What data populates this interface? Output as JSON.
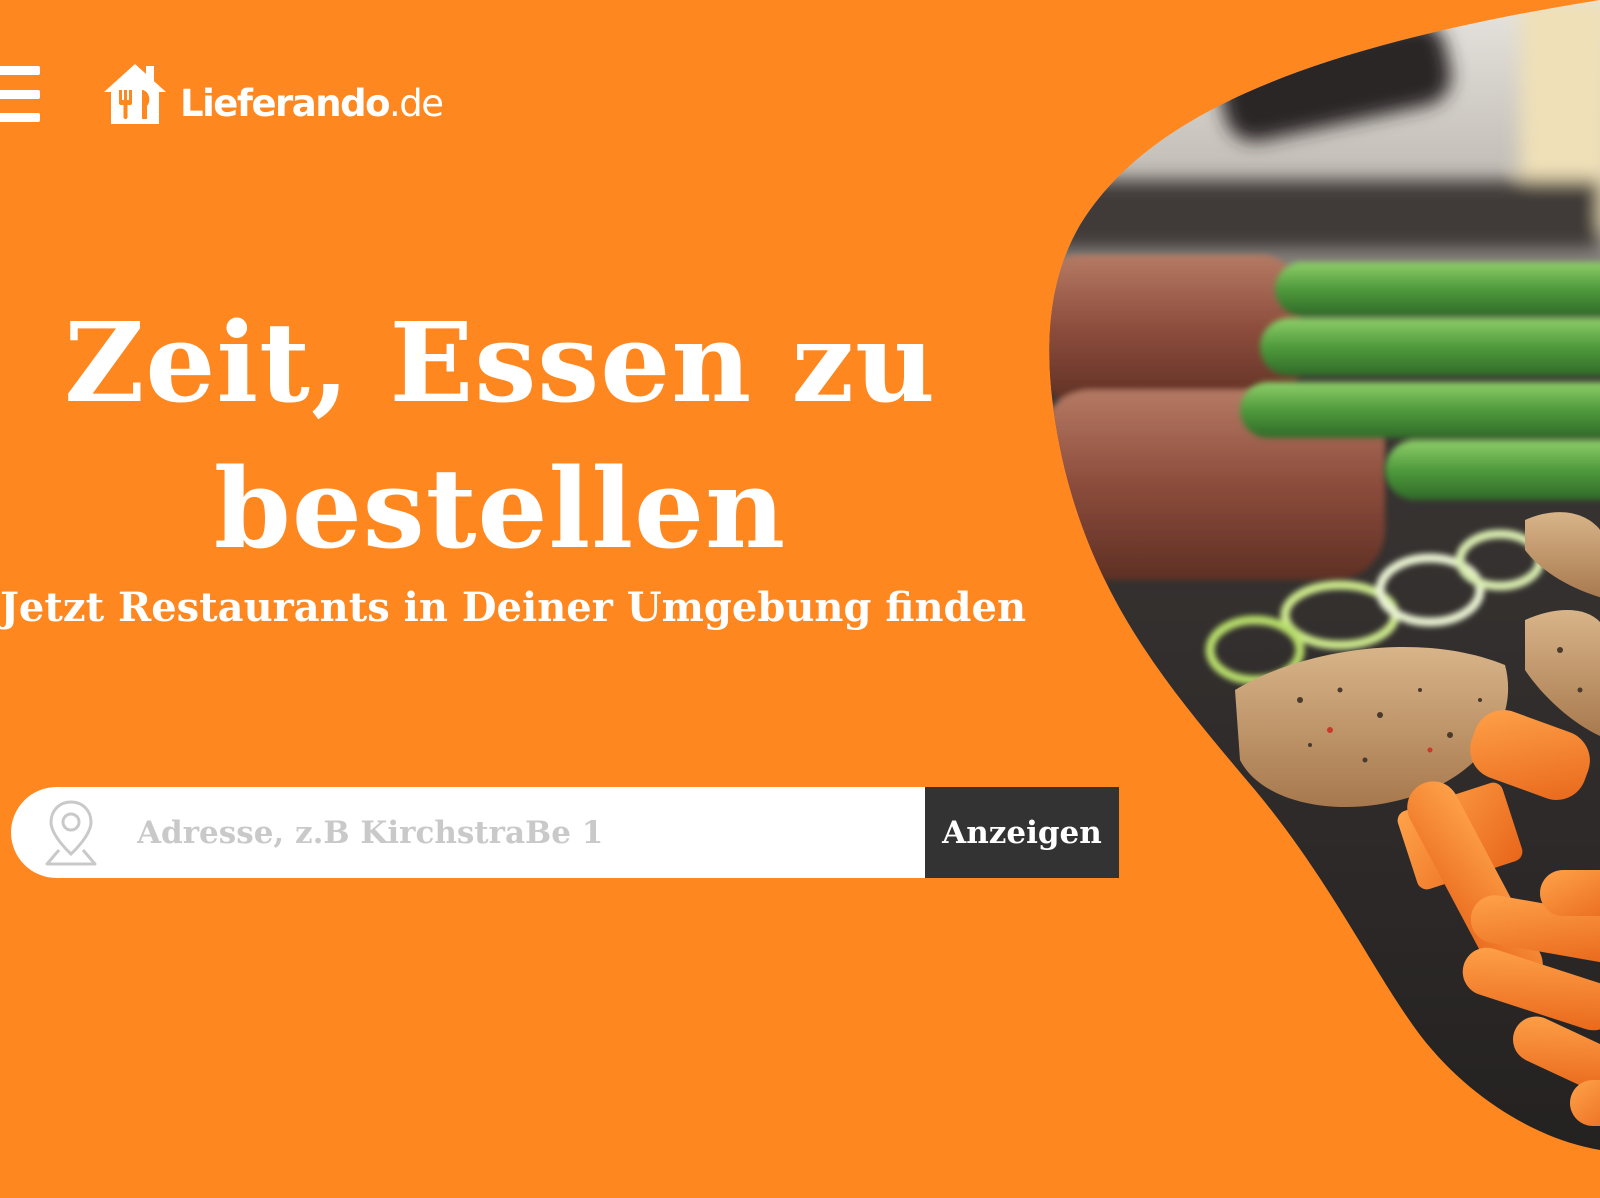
{
  "header": {
    "menu_icon": "hamburger-menu-icon",
    "logo": {
      "icon": "house-with-fork-knife-icon",
      "name": "Lieferando",
      "tld": ".de"
    }
  },
  "hero": {
    "title_line1": "Zeit, Essen zu",
    "title_line2": "bestellen",
    "subtitle": "Jetzt Restaurants in Deiner Umgebung finden"
  },
  "search": {
    "icon": "location-pin-icon",
    "value": "",
    "placeholder": "Adresse, z.B KirchstraBe 1",
    "button_label": "Anzeigen"
  },
  "colors": {
    "brand_orange": "#FF8720",
    "button_dark": "#333333",
    "white": "#FFFFFF"
  }
}
